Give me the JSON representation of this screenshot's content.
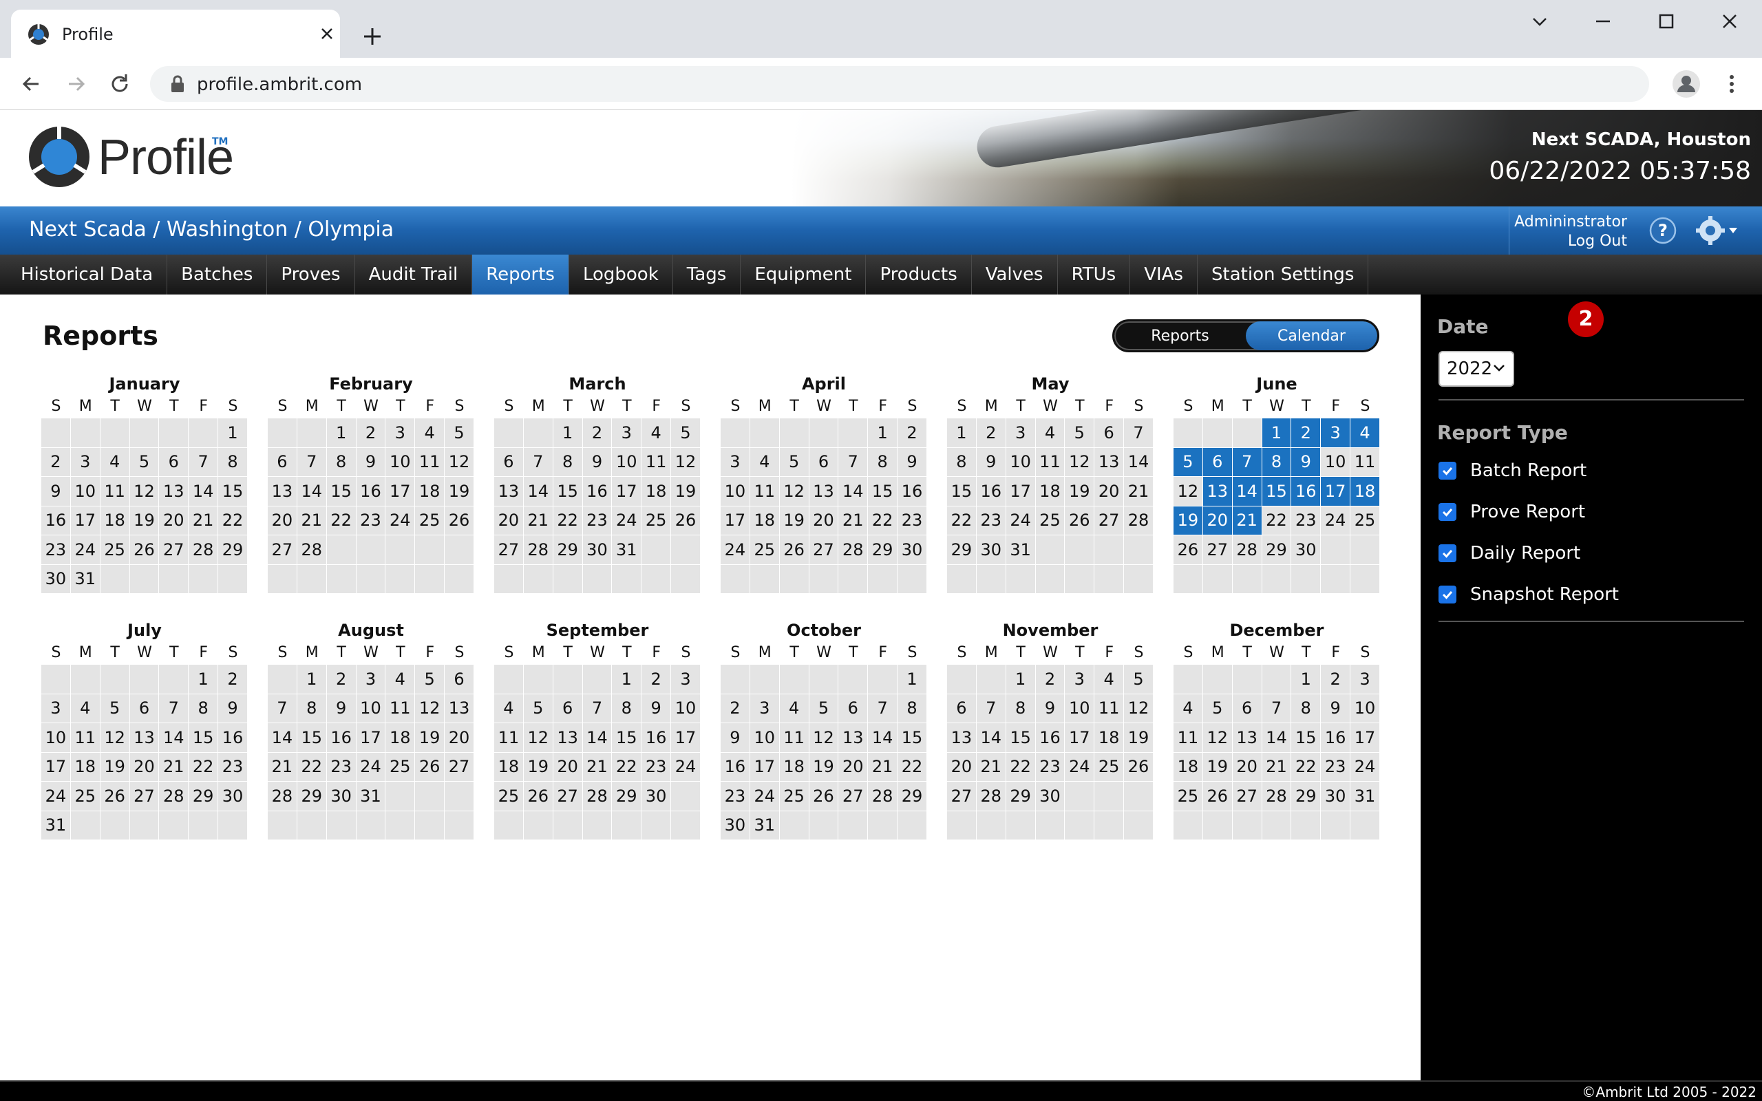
{
  "browser": {
    "tab_title": "Profile",
    "url": "profile.ambrit.com"
  },
  "header": {
    "logo_text": "Profile",
    "logo_tm": "TM",
    "site_name": "Next SCADA, Houston",
    "datetime": "06/22/2022 05:37:58"
  },
  "crumb": {
    "path": "Next Scada / Washington / Olympia",
    "user": "Admininstrator",
    "logout": "Log Out"
  },
  "nav": {
    "items": [
      "Historical Data",
      "Batches",
      "Proves",
      "Audit Trail",
      "Reports",
      "Logbook",
      "Tags",
      "Equipment",
      "Products",
      "Valves",
      "RTUs",
      "VIAs",
      "Station Settings"
    ],
    "active": "Reports"
  },
  "content": {
    "title": "Reports",
    "toggle": {
      "reports": "Reports",
      "calendar": "Calendar",
      "active": "calendar"
    }
  },
  "calendar": {
    "year": 2022,
    "weekday_headers": [
      "S",
      "M",
      "T",
      "W",
      "T",
      "F",
      "S"
    ],
    "months": [
      {
        "name": "January",
        "start": 6,
        "days": 31
      },
      {
        "name": "February",
        "start": 2,
        "days": 28
      },
      {
        "name": "March",
        "start": 2,
        "days": 31
      },
      {
        "name": "April",
        "start": 5,
        "days": 30
      },
      {
        "name": "May",
        "start": 0,
        "days": 31
      },
      {
        "name": "June",
        "start": 3,
        "days": 30,
        "highlighted": [
          1,
          2,
          3,
          4,
          5,
          6,
          7,
          8,
          9,
          13,
          14,
          15,
          16,
          17,
          18,
          19,
          20,
          21
        ]
      },
      {
        "name": "July",
        "start": 5,
        "days": 31
      },
      {
        "name": "August",
        "start": 1,
        "days": 31
      },
      {
        "name": "September",
        "start": 4,
        "days": 30
      },
      {
        "name": "October",
        "start": 6,
        "days": 31
      },
      {
        "name": "November",
        "start": 2,
        "days": 30
      },
      {
        "name": "December",
        "start": 4,
        "days": 31
      }
    ]
  },
  "side": {
    "date_label": "Date",
    "badge": "2",
    "year_value": "2022",
    "report_type_label": "Report Type",
    "report_types": [
      {
        "label": "Batch Report",
        "checked": true
      },
      {
        "label": "Prove Report",
        "checked": true
      },
      {
        "label": "Daily Report",
        "checked": true
      },
      {
        "label": "Snapshot Report",
        "checked": true
      }
    ]
  },
  "footer": {
    "copyright": "©Ambrit Ltd 2005 - 2022"
  },
  "colors": {
    "accent": "#1b72c0",
    "nav_dark": "#151515",
    "badge": "#c50000"
  }
}
